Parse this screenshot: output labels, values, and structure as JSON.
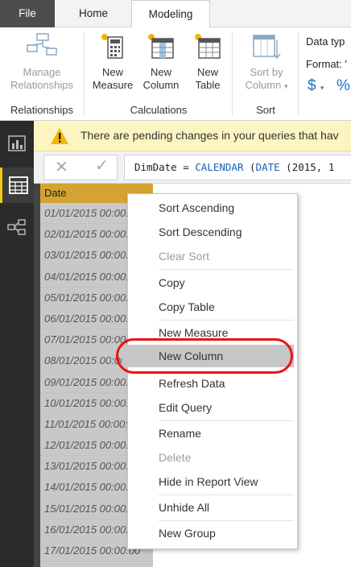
{
  "tabs": [
    "File",
    "Home",
    "Modeling"
  ],
  "active_tab": "Modeling",
  "ribbon": {
    "relationships": {
      "button": "Manage Relationships",
      "button_line1": "Manage",
      "button_line2": "Relationships",
      "group_label": "Relationships"
    },
    "calculations": {
      "new_measure": {
        "line1": "New",
        "line2": "Measure"
      },
      "new_column": {
        "line1": "New",
        "line2": "Column"
      },
      "new_table": {
        "line1": "New",
        "line2": "Table"
      },
      "group_label": "Calculations"
    },
    "sort": {
      "line1": "Sort by",
      "line2": "Column",
      "group_label": "Sort"
    },
    "formatting": {
      "data_type": "Data typ",
      "format": "Format: '",
      "currency": "$",
      "percent": "%"
    }
  },
  "warning": {
    "text": "There are pending changes in your queries that hav"
  },
  "left_nav": [
    "report-view",
    "data-view",
    "relationships-view"
  ],
  "formula_bar": {
    "prefix": "DimDate = ",
    "func1": "CALENDAR",
    "mid": " (",
    "func2": "DATE",
    "suffix": " (2015, 1"
  },
  "table": {
    "column_header": "Date",
    "rows": [
      "01/01/2015 00:00:00",
      "02/01/2015 00:00:00",
      "03/01/2015 00:00:00",
      "04/01/2015 00:00:00",
      "05/01/2015 00:00:00",
      "06/01/2015 00:00:00",
      "07/01/2015 00:00:00",
      "08/01/2015 00:00:00",
      "09/01/2015 00:00:00",
      "10/01/2015 00:00:00",
      "11/01/2015 00:00:00",
      "12/01/2015 00:00:00",
      "13/01/2015 00:00:00",
      "14/01/2015 00:00:00",
      "15/01/2015 00:00:00",
      "16/01/2015 00:00:00",
      "17/01/2015 00:00:00"
    ]
  },
  "context_menu": {
    "sort_ascending": "Sort Ascending",
    "sort_descending": "Sort Descending",
    "clear_sort": "Clear Sort",
    "copy": "Copy",
    "copy_table": "Copy Table",
    "new_measure": "New Measure",
    "new_column": "New Column",
    "refresh_data": "Refresh Data",
    "edit_query": "Edit Query",
    "rename": "Rename",
    "delete": "Delete",
    "hide_in_report_view": "Hide in Report View",
    "unhide_all": "Unhide All",
    "new_group": "New Group"
  },
  "colors": {
    "accent_header": "#d4a331",
    "highlight_oval": "#e11111",
    "warning_bg": "#fcf5c2",
    "nav_bg": "#2b2b2b"
  }
}
